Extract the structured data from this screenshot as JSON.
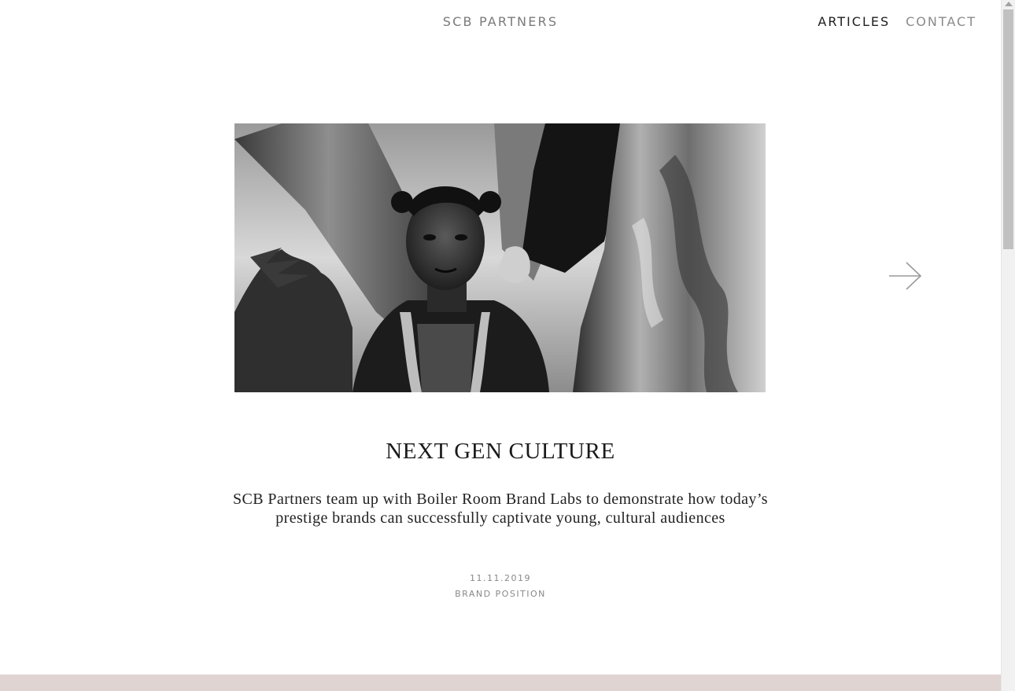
{
  "header": {
    "brand": "SCB PARTNERS",
    "nav": [
      {
        "label": "ARTICLES",
        "active": true
      },
      {
        "label": "CONTACT",
        "active": false
      }
    ]
  },
  "article": {
    "title": "NEXT GEN CULTURE",
    "excerpt": "SCB Partners team up with Boiler Room Brand Labs to demonstrate how today’s prestige brands can successfully captivate young, cultural audiences",
    "date": "11.11.2019",
    "category": "BRAND POSITION"
  },
  "icons": {
    "next": "arrow-right-icon"
  },
  "colors": {
    "nav_active": "#1e1e1e",
    "nav_inactive": "#8a8a8a",
    "band": "#e0d4d3"
  }
}
